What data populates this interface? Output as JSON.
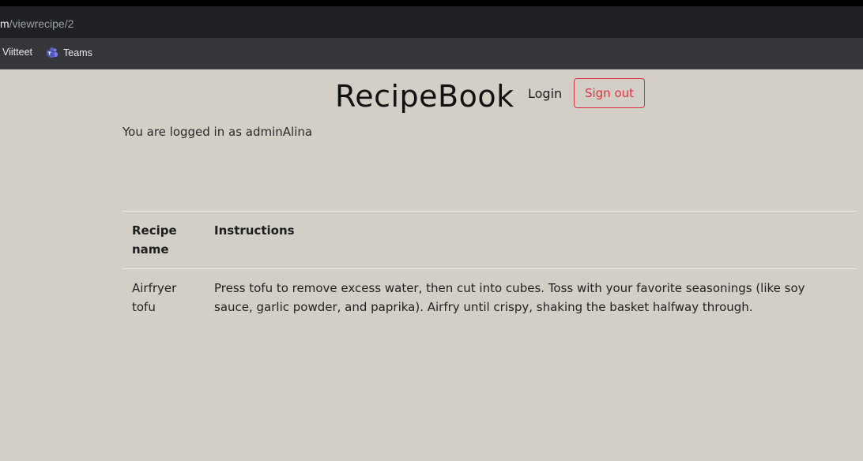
{
  "browser": {
    "url_host": "m",
    "url_path": "/viewrecipe/2",
    "bookmarks": [
      {
        "label": "Viitteet"
      },
      {
        "label": "Teams",
        "icon": "teams-icon"
      }
    ]
  },
  "site": {
    "title": "RecipeBook",
    "login_label": "Login",
    "signout_label": "Sign out",
    "logged_in_text": "You are logged in as adminAlina"
  },
  "table": {
    "headers": [
      "Recipe name",
      "Instructions"
    ],
    "rows": [
      {
        "name": "Airfryer tofu",
        "instructions": "Press tofu to remove excess water, then cut into cubes. Toss with your favorite seasonings (like soy sauce, garlic powder, and paprika). Airfry until crispy, shaking the basket halfway through."
      }
    ]
  },
  "colors": {
    "page_background": "#d3cec6",
    "signout_accent": "#dc3545",
    "teams_purple": "#5b5fc7"
  }
}
